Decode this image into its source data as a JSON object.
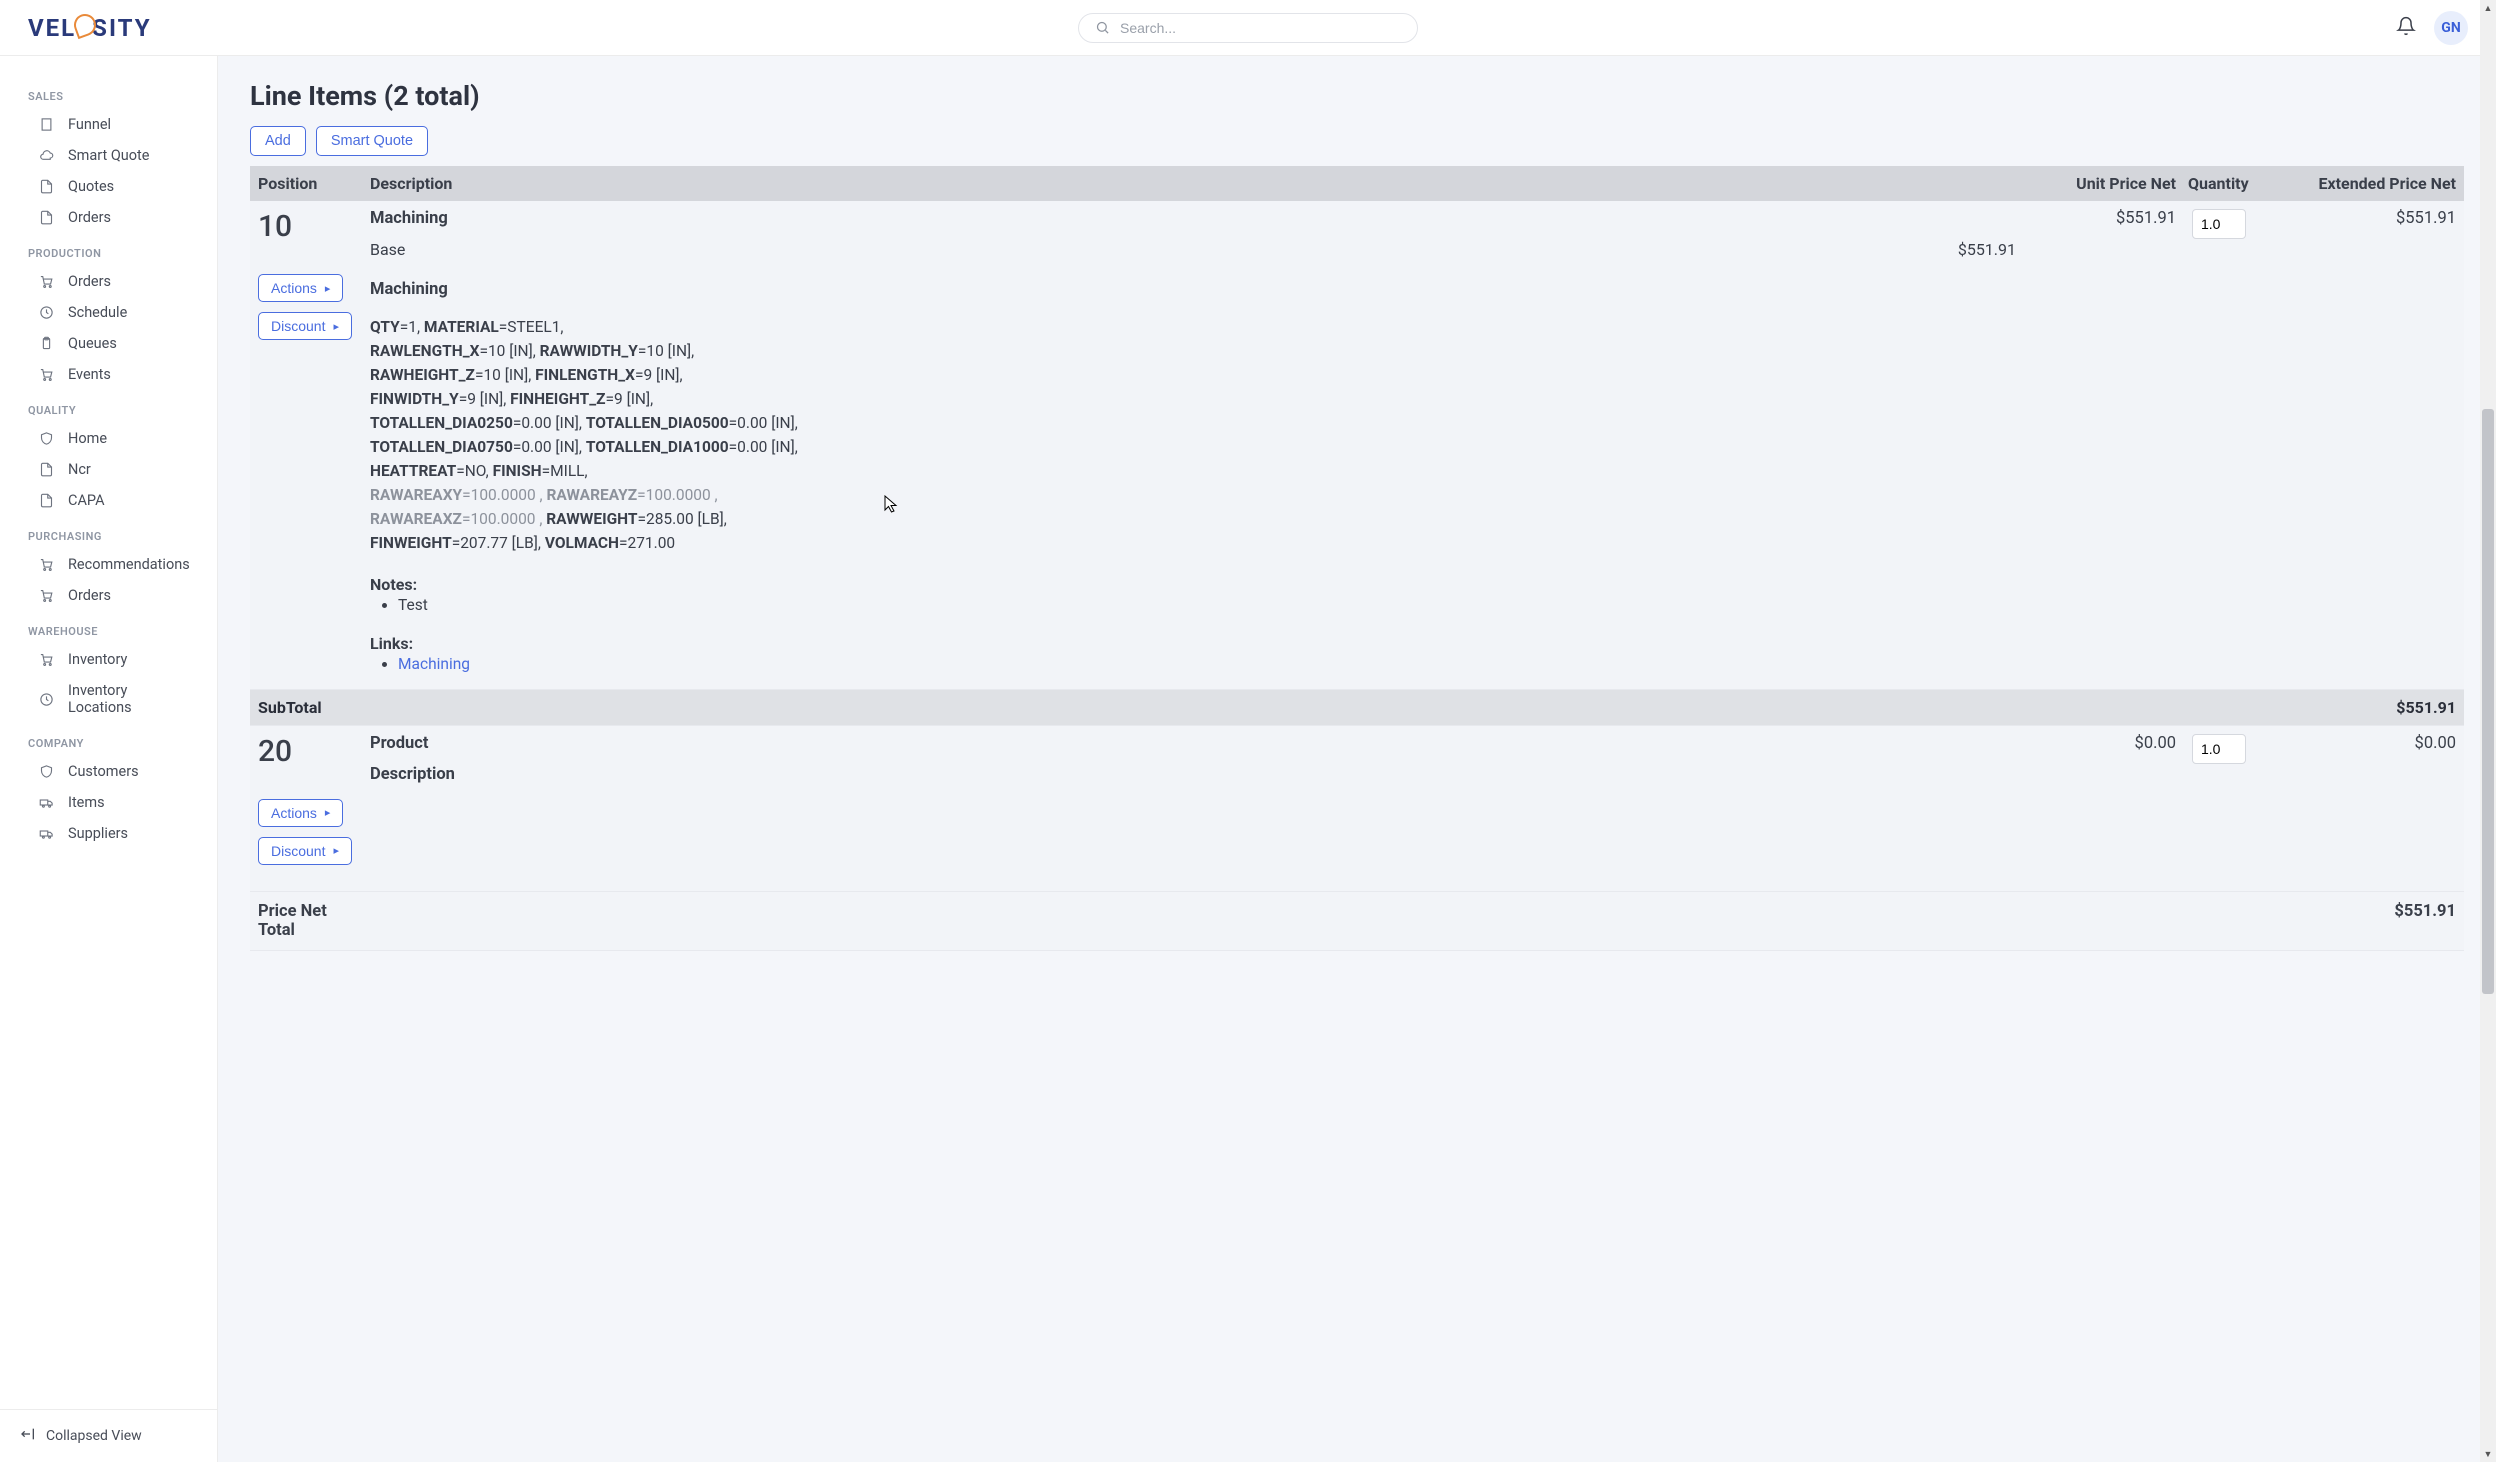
{
  "brand": "VELOSITY",
  "search": {
    "placeholder": "Search..."
  },
  "user": {
    "initials": "GN"
  },
  "sidebar": {
    "sections": [
      {
        "label": "SALES",
        "items": [
          {
            "label": "Funnel",
            "icon": "building"
          },
          {
            "label": "Smart Quote",
            "icon": "cloud"
          },
          {
            "label": "Quotes",
            "icon": "doc"
          },
          {
            "label": "Orders",
            "icon": "doc"
          }
        ]
      },
      {
        "label": "PRODUCTION",
        "items": [
          {
            "label": "Orders",
            "icon": "cart"
          },
          {
            "label": "Schedule",
            "icon": "clock"
          },
          {
            "label": "Queues",
            "icon": "clipboard"
          },
          {
            "label": "Events",
            "icon": "cart"
          }
        ]
      },
      {
        "label": "QUALITY",
        "items": [
          {
            "label": "Home",
            "icon": "shield"
          },
          {
            "label": "Ncr",
            "icon": "doc"
          },
          {
            "label": "CAPA",
            "icon": "doc"
          }
        ]
      },
      {
        "label": "PURCHASING",
        "items": [
          {
            "label": "Recommendations",
            "icon": "cart"
          },
          {
            "label": "Orders",
            "icon": "cart"
          }
        ]
      },
      {
        "label": "WAREHOUSE",
        "items": [
          {
            "label": "Inventory",
            "icon": "cart"
          },
          {
            "label": "Inventory Locations",
            "icon": "clock"
          }
        ]
      },
      {
        "label": "COMPANY",
        "items": [
          {
            "label": "Customers",
            "icon": "shield"
          },
          {
            "label": "Items",
            "icon": "truck"
          },
          {
            "label": "Suppliers",
            "icon": "truck"
          }
        ]
      }
    ],
    "collapse_label": "Collapsed View"
  },
  "main": {
    "title": "Line Items (2 total)",
    "buttons": {
      "add": "Add",
      "smart_quote": "Smart Quote"
    },
    "columns": {
      "position": "Position",
      "description": "Description",
      "unit": "Unit Price Net",
      "qty": "Quantity",
      "ext": "Extended Price Net"
    },
    "row_actions": {
      "actions": "Actions",
      "discount": "Discount"
    },
    "items": [
      {
        "position": "10",
        "title": "Machining",
        "base_label": "Base",
        "base_price": "$551.91",
        "unit_price": "$551.91",
        "qty": "1.0",
        "ext_price": "$551.91",
        "spec_title": "Machining",
        "specs": [
          [
            {
              "k": "QTY",
              "v": "=1, "
            },
            {
              "k": "MATERIAL",
              "v": "=STEEL1,"
            }
          ],
          [
            {
              "k": "RAWLENGTH_X",
              "v": "=10 [IN], "
            },
            {
              "k": "RAWWIDTH_Y",
              "v": "=10 [IN],"
            }
          ],
          [
            {
              "k": "RAWHEIGHT_Z",
              "v": "=10 [IN], "
            },
            {
              "k": "FINLENGTH_X",
              "v": "=9 [IN],"
            }
          ],
          [
            {
              "k": "FINWIDTH_Y",
              "v": "=9 [IN], "
            },
            {
              "k": "FINHEIGHT_Z",
              "v": "=9 [IN],"
            }
          ],
          [
            {
              "k": "TOTALLEN_DIA0250",
              "v": "=0.00 [IN], "
            },
            {
              "k": "TOTALLEN_DIA0500",
              "v": "=0.00 [IN],"
            }
          ],
          [
            {
              "k": "TOTALLEN_DIA0750",
              "v": "=0.00 [IN], "
            },
            {
              "k": "TOTALLEN_DIA1000",
              "v": "=0.00 [IN],"
            }
          ],
          [
            {
              "k": "HEATTREAT",
              "v": "=NO, "
            },
            {
              "k": "FINISH",
              "v": "=MILL,"
            }
          ],
          [
            {
              "k": "RAWAREAXY",
              "v": "=100.0000 , ",
              "g": true
            },
            {
              "k": "RAWAREAYZ",
              "v": "=100.0000 ,",
              "g": true
            }
          ],
          [
            {
              "k": "RAWAREAXZ",
              "v": "=100.0000 , ",
              "g": true
            },
            {
              "k": "RAWWEIGHT",
              "v": "=285.00 [LB],"
            }
          ],
          [
            {
              "k": "FINWEIGHT",
              "v": "=207.77 [LB], "
            },
            {
              "k": "VOLMACH",
              "v": "=271.00"
            }
          ]
        ],
        "notes_label": "Notes:",
        "notes": [
          "Test"
        ],
        "links_label": "Links:",
        "links": [
          {
            "text": "Machining"
          }
        ]
      },
      {
        "position": "20",
        "title": "Product",
        "sub_title": "Description",
        "unit_price": "$0.00",
        "qty": "1.0",
        "ext_price": "$0.00"
      }
    ],
    "subtotal": {
      "label": "SubTotal",
      "value": "$551.91"
    },
    "total": {
      "label": "Price Net Total",
      "value": "$551.91"
    }
  }
}
